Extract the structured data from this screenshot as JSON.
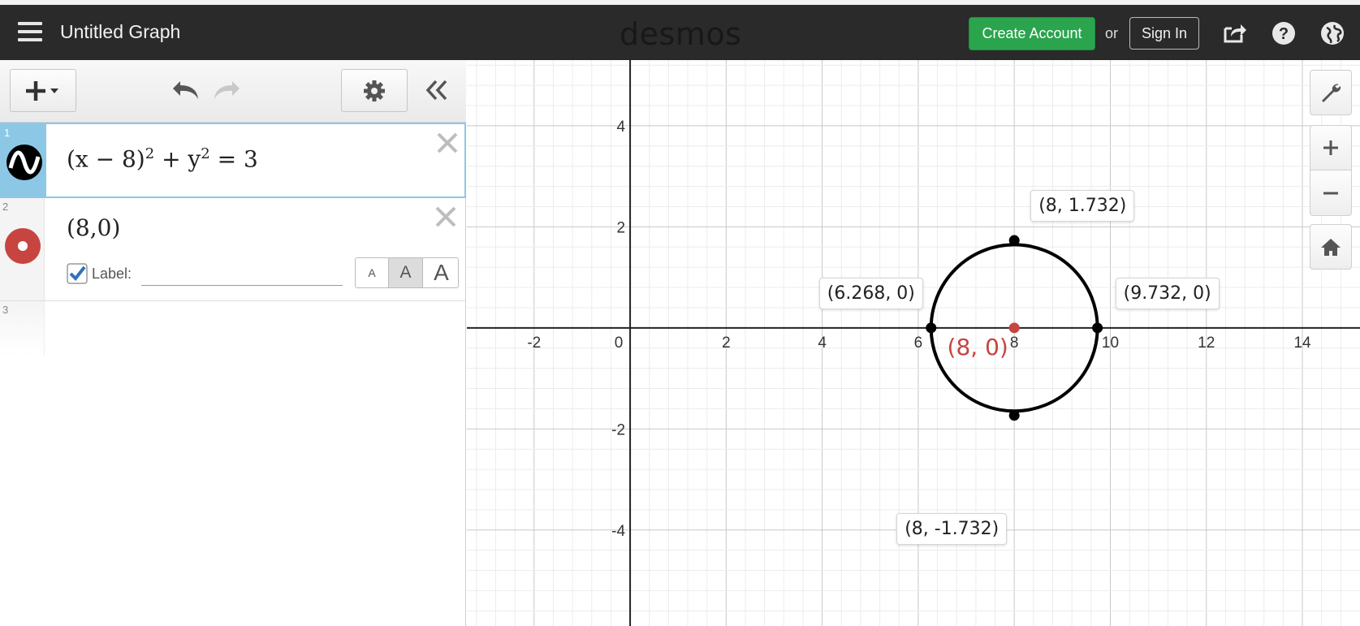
{
  "header": {
    "title": "Untitled Graph",
    "logo": "desmos",
    "create_account": "Create Account",
    "or": "or",
    "sign_in": "Sign In",
    "icons": [
      "menu-icon",
      "share-icon",
      "help-icon",
      "globe-icon"
    ]
  },
  "toolbar": {
    "add_label": "+",
    "icons": [
      "add-icon",
      "undo-icon",
      "redo-icon",
      "gear-icon",
      "collapse-icon"
    ]
  },
  "expressions": [
    {
      "index": "1",
      "latex_parts": [
        "(x − 8)",
        "2",
        " + y",
        "2",
        " = 3"
      ],
      "color": "#000000"
    },
    {
      "index": "2",
      "text": "(8,0)",
      "color": "#c74440",
      "label_checkbox": "Label:",
      "label_value": "",
      "sizes": [
        "A",
        "A",
        "A"
      ]
    },
    {
      "index": "3"
    }
  ],
  "graph": {
    "x_ticks": [
      "-2",
      "0",
      "2",
      "4",
      "6",
      "8",
      "10",
      "12",
      "14"
    ],
    "y_ticks": [
      "4",
      "2",
      "-2",
      "-4"
    ],
    "xlim": [
      -3.4,
      15.2
    ],
    "ylim": [
      -5.9,
      5.3
    ],
    "circle": {
      "h": 8,
      "k": 0,
      "r": 1.732
    },
    "points": [
      {
        "label": "(8, 1.732)",
        "x": 8,
        "y": 1.732
      },
      {
        "label": "(6.268, 0)",
        "x": 6.268,
        "y": 0
      },
      {
        "label": "(9.732, 0)",
        "x": 9.732,
        "y": 0
      },
      {
        "label": "(8, -1.732)",
        "x": 8,
        "y": -1.732
      }
    ],
    "center_label": "(8, 0)",
    "center_color": "#c74440",
    "icons": [
      "wrench-icon",
      "zoom-in-icon",
      "zoom-out-icon",
      "home-icon"
    ]
  }
}
